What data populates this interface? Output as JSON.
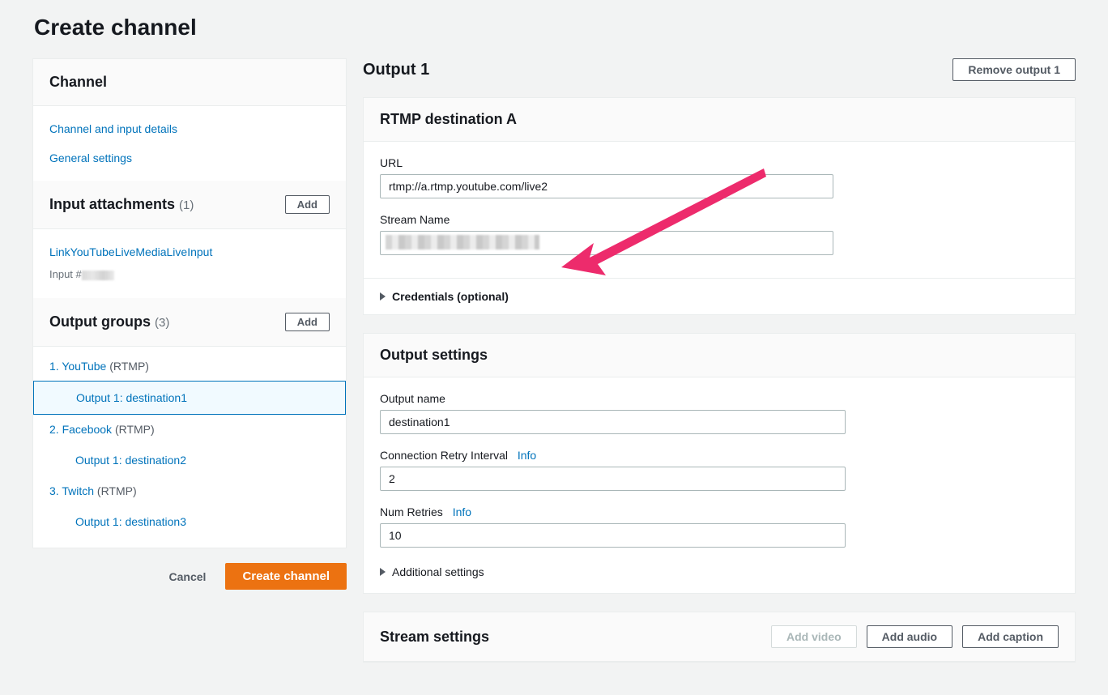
{
  "page_title": "Create channel",
  "sidebar": {
    "channel_header": "Channel",
    "channel_links": {
      "details": "Channel and input details",
      "general": "General settings"
    },
    "input_attachments": {
      "title": "Input attachments",
      "count": "(1)",
      "add_label": "Add",
      "link": "LinkYouTubeLiveMediaLiveInput",
      "sub_prefix": "Input #"
    },
    "output_groups": {
      "title": "Output groups",
      "count": "(3)",
      "add_label": "Add",
      "items": [
        {
          "num": "1.",
          "name": "YouTube",
          "type": "(RTMP)",
          "child": "Output 1: destination1",
          "selected": true
        },
        {
          "num": "2.",
          "name": "Facebook",
          "type": "(RTMP)",
          "child": "Output 1: destination2",
          "selected": false
        },
        {
          "num": "3.",
          "name": "Twitch",
          "type": "(RTMP)",
          "child": "Output 1: destination3",
          "selected": false
        }
      ]
    },
    "actions": {
      "cancel": "Cancel",
      "create": "Create channel"
    }
  },
  "main": {
    "output_heading": "Output 1",
    "remove_output": "Remove output 1",
    "rtmp": {
      "title": "RTMP destination A",
      "url_label": "URL",
      "url_value": "rtmp://a.rtmp.youtube.com/live2",
      "stream_label": "Stream Name",
      "credentials": "Credentials (optional)"
    },
    "output_settings": {
      "title": "Output settings",
      "name_label": "Output name",
      "name_value": "destination1",
      "retry_label": "Connection Retry Interval",
      "retry_value": "2",
      "num_retries_label": "Num Retries",
      "num_retries_value": "10",
      "info": "Info",
      "additional": "Additional settings"
    },
    "stream_settings": {
      "title": "Stream settings",
      "add_video": "Add video",
      "add_audio": "Add audio",
      "add_caption": "Add caption"
    }
  }
}
